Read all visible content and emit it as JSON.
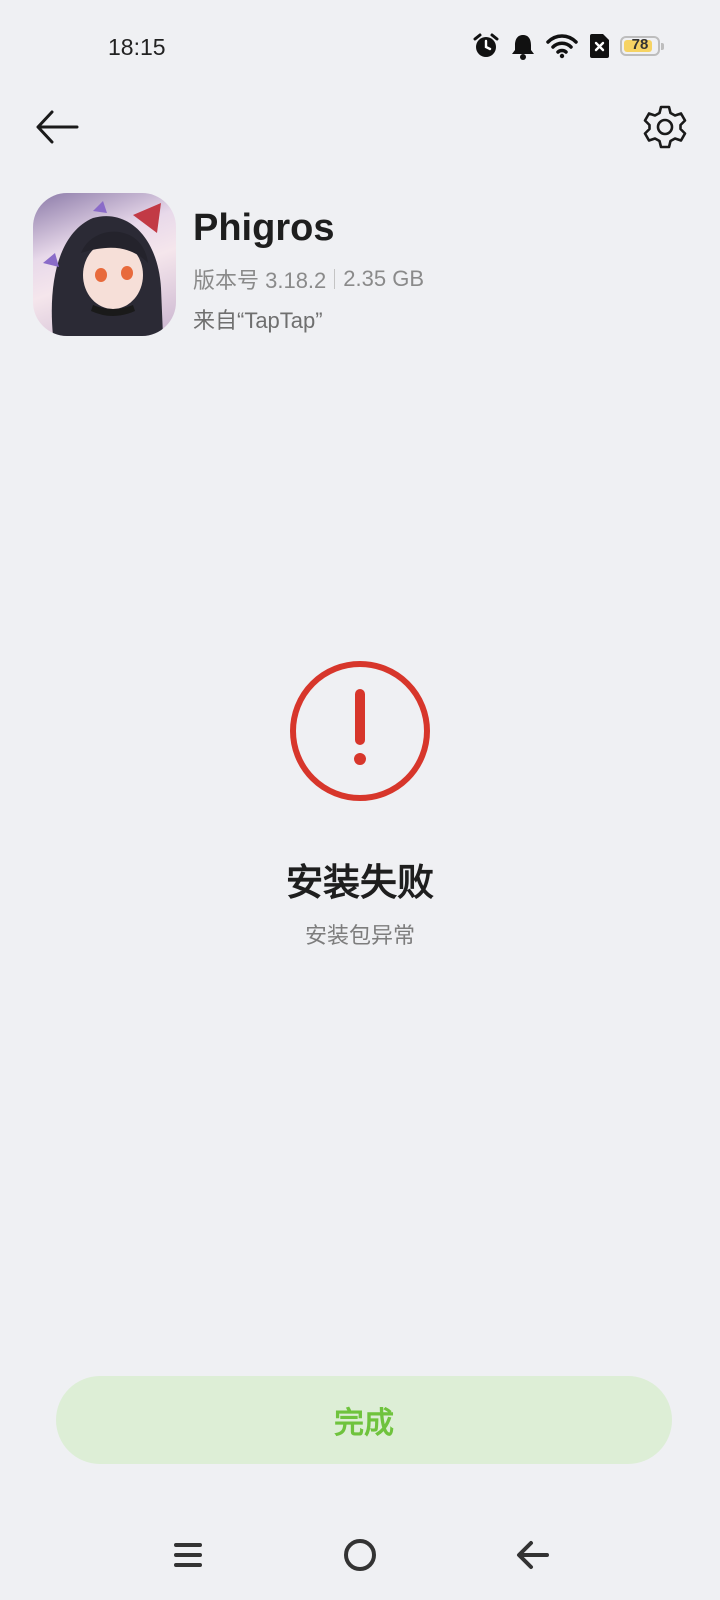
{
  "status_bar": {
    "time": "18:15",
    "battery_level": "78",
    "icons": [
      "alarm-icon",
      "bell-icon",
      "wifi-icon",
      "sim-icon",
      "battery-icon"
    ]
  },
  "toolbar": {
    "back_icon": "arrow-left-icon",
    "settings_icon": "gear-icon"
  },
  "app": {
    "name": "Phigros",
    "version": "版本号 3.18.2",
    "size": "2.35 GB",
    "source": "来自“TapTap”"
  },
  "result": {
    "icon": "error-exclamation-icon",
    "title": "安装失败",
    "subtitle": "安装包异常",
    "accent_color": "#d7362b"
  },
  "done_button": {
    "label": "完成",
    "text_color": "#6fc33d",
    "bg_color": "#ddeed6"
  },
  "nav_bar": {
    "items": [
      "menu-icon",
      "home-icon",
      "back-icon"
    ]
  }
}
